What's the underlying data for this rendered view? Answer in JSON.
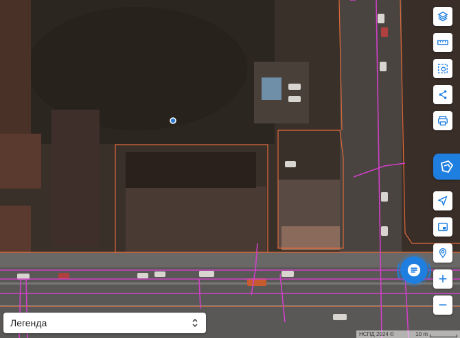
{
  "toolbar": {
    "items": [
      {
        "name": "layers-button",
        "icon": "layers-icon"
      },
      {
        "name": "ruler-button",
        "icon": "ruler-icon"
      },
      {
        "name": "select-area-button",
        "icon": "select-area-icon"
      },
      {
        "name": "share-button",
        "icon": "share-icon"
      },
      {
        "name": "print-button",
        "icon": "print-icon"
      }
    ],
    "side_tab_icon": "logo-icon",
    "secondary": [
      {
        "name": "navigate-button",
        "icon": "navigation-arrow-icon"
      },
      {
        "name": "inset-map-button",
        "icon": "picture-in-picture-icon"
      },
      {
        "name": "search-location-button",
        "icon": "location-search-icon"
      }
    ],
    "zoom_in": "+",
    "zoom_out": "−"
  },
  "chat": {
    "icon": "chat-icon"
  },
  "legend": {
    "label": "Легенда",
    "icon": "chevron-updown-icon"
  },
  "attribution": {
    "text": "НСПД 2024 ©",
    "scale_label": "10 m"
  },
  "colors": {
    "accent": "#1f7fe0",
    "parcel_boundary": "#e06a3a",
    "engineering_lines": "#d040c8"
  }
}
